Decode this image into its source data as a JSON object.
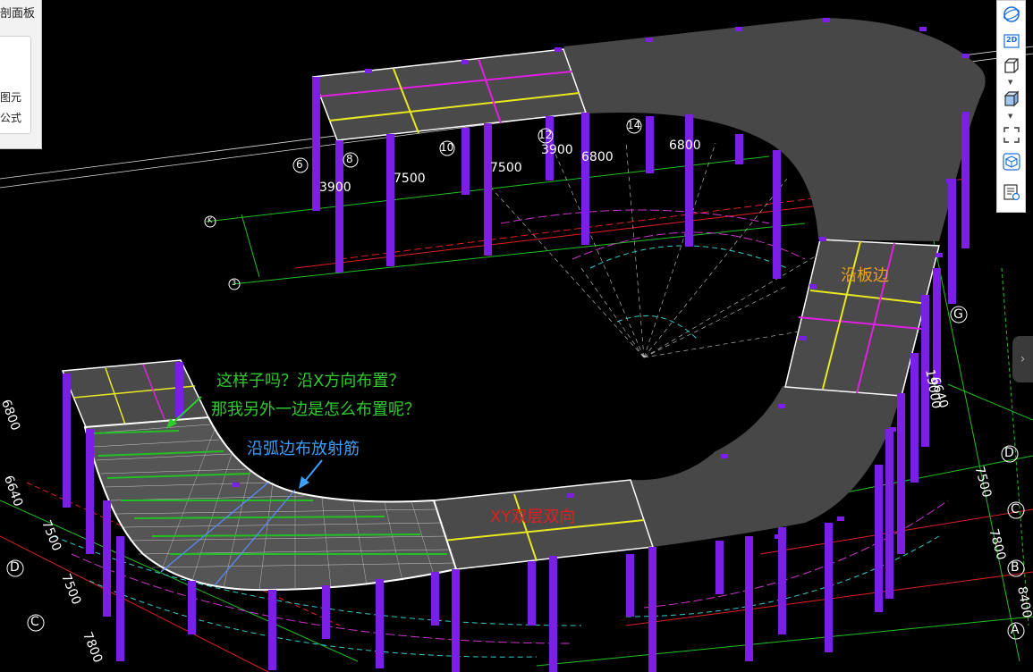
{
  "left_panel": {
    "title": "剖面板",
    "items": [
      "图元",
      "公式"
    ]
  },
  "toolbar": {
    "icons": [
      "view-3d-rotate-icon",
      "view-2d-icon",
      "box-view-icon",
      "solid-box-icon",
      "fit-window-icon",
      "3d-cube-icon",
      "property-list-icon"
    ],
    "label_2d": "2D"
  },
  "annotations": {
    "question_1": "这样子吗？沿X方向布置？",
    "question_2": "那我另外一边是怎么布置呢？",
    "arc_note": "沿弧边布放射筋",
    "edge_note": "沿板边",
    "xy_note": "XY双层双向"
  },
  "colors": {
    "question_green": "#2ecc2e",
    "arc_note_blue": "#3da0ff",
    "edge_note_orange": "#f0a020",
    "xy_note_red": "#e02020",
    "slab_gray": "#4a4a4a",
    "column_purple": "#7b1fe6",
    "rebar_yellow": "#e8e820",
    "rebar_magenta": "#e020e0"
  },
  "axis_labels": {
    "top_numbers": [
      "6",
      "8",
      "10",
      "12",
      "14"
    ],
    "top_dims": [
      "3900",
      "7500",
      "7500",
      "3900",
      "6800",
      "6800"
    ],
    "right_letters": [
      "G",
      "D",
      "C",
      "B",
      "A"
    ],
    "right_dims": [
      "6640",
      "19000",
      "7500",
      "7800",
      "8400"
    ],
    "left_letters": [
      "D",
      "C"
    ],
    "left_dims": [
      "6640",
      "7500",
      "7500",
      "7800",
      "6800"
    ],
    "top_left_letters": [
      "K",
      "3"
    ]
  }
}
